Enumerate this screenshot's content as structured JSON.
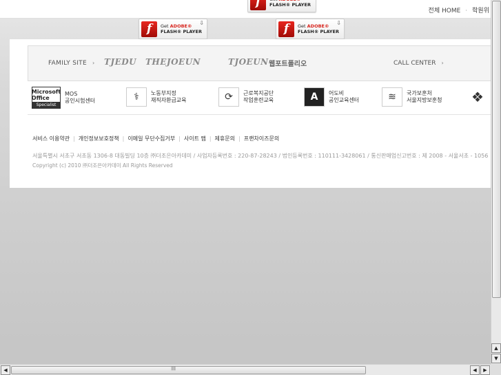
{
  "top_links": {
    "home": "전체 HOME",
    "separator": "·",
    "next": "학원위"
  },
  "flash_banner": {
    "line1_prefix": "Get ",
    "line1_brand": "ADOBE®",
    "line2": "FLASH® PLAYER",
    "logo_glyph": "f",
    "download_glyph": "⇩"
  },
  "family_bar": {
    "label": "FAMILY SITE",
    "arrow": "›",
    "brands": [
      "TJEDU",
      "THEJOEUN",
      "TJOEUN"
    ],
    "webfolio": "웹포트폴리오",
    "call_center": "CALL CENTER"
  },
  "partners": [
    {
      "logo_text": "Microsoft Office",
      "badge": "Specialist",
      "name": "MOS\n공인시험센터"
    },
    {
      "logo_text": "⚕",
      "name": "노동부지정\n재직자환급교육"
    },
    {
      "logo_text": "⟳",
      "name": "근로복지공단\n작업훈련교육"
    },
    {
      "logo_text": "A",
      "name": "어도비\n공인교육센터"
    },
    {
      "logo_text": "≋",
      "name": "국가보훈처\n서울지방보훈청"
    },
    {
      "logo_text": "❖",
      "name": ""
    }
  ],
  "footer_links": [
    "서비스 이용약관",
    "개인정보보호정책",
    "이메일 무단수집거부",
    "사이트 맵",
    "제휴문의",
    "프랜차이즈문의"
  ],
  "address": "서울특별시 서초구 서초동 1306-8 대동빌딩 10층 ㈜더조은아카데미 / 사업자등록번호 : 220-87-28243 / 법인등록번호 : 110111-3428061 / 통신판매업신고번호 : 제 2008 - 서울서초 - 1056",
  "copyright": "Copyright (c) 2010 ㈜더조은아카데미  All Rights Reserved",
  "scrollbar": {
    "up": "▲",
    "down": "▼",
    "left": "◀",
    "right": "▶",
    "grip": "||||||"
  }
}
